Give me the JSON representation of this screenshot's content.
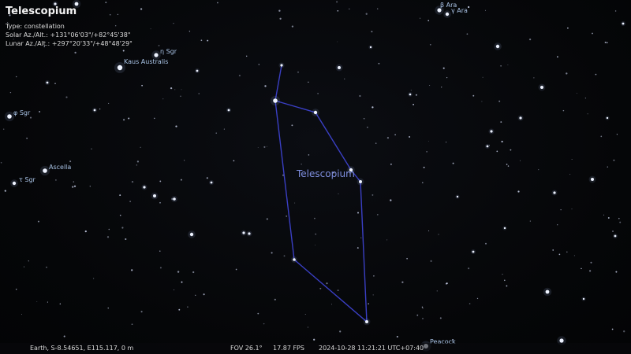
{
  "app": {
    "object_title": "Telescopium",
    "info": {
      "type": "Type: constellation",
      "solar": "Solar Az./Alt.: +131°06'03\"/+82°45'38\"",
      "lunar": "Lunar Az./Alt.: +297°20'33\"/+48°48'29\""
    }
  },
  "labels": {
    "constellation": "Telescopium",
    "stars": [
      {
        "id": "beta-ara",
        "text": "β Ara"
      },
      {
        "id": "gamma-ara",
        "text": "γ Ara"
      },
      {
        "id": "eta-sgr",
        "text": "η Sgr"
      },
      {
        "id": "kaus-australis",
        "text": "Kaus Australis"
      },
      {
        "id": "phi-sgr",
        "text": "φ Sgr"
      },
      {
        "id": "ascella",
        "text": "Ascella"
      },
      {
        "id": "tau-sgr",
        "text": "τ Sgr"
      },
      {
        "id": "peacock",
        "text": "Peacock"
      }
    ]
  },
  "status_bar": {
    "location": "Earth, S-8.54651, E115.117, 0 m",
    "fov": "FOV 26.1°",
    "fps": "17.87 FPS",
    "datetime": "2024-10-28 11:21:21 UTC+07:40"
  },
  "colors": {
    "constellation_line": "#3a3fc4",
    "constellation_label": "#7f8fe0",
    "star_label": "#a9c3e6"
  }
}
